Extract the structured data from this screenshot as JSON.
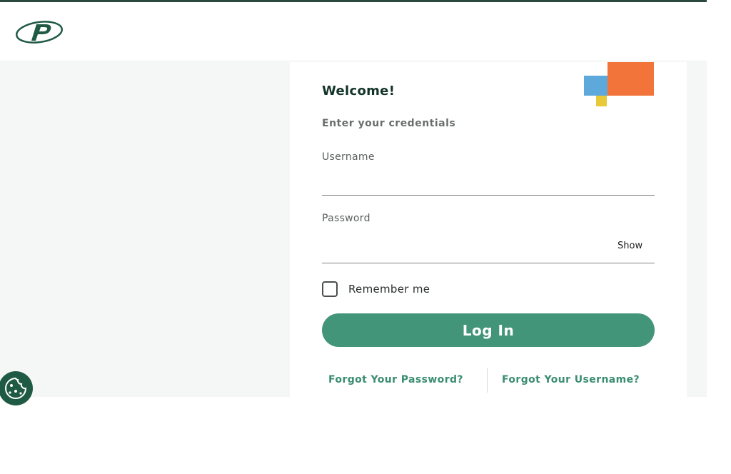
{
  "brand": {
    "logo_icon": "p-monogram-logo",
    "colors": {
      "primary": "#43957a",
      "dark_green": "#1f5a44",
      "orange": "#f2743a",
      "blue": "#5ea9dc",
      "yellow": "#e8c93a"
    }
  },
  "login": {
    "title": "Welcome!",
    "subtitle": "Enter your credentials",
    "username_label": "Username",
    "username_value": "",
    "password_label": "Password",
    "password_value": "",
    "show_label": "Show",
    "remember_label": "Remember me",
    "remember_checked": false,
    "submit_label": "Log In",
    "forgot_password": "Forgot Your Password?",
    "forgot_username": "Forgot Your Username?"
  },
  "cookie": {
    "icon": "cookie-icon"
  }
}
